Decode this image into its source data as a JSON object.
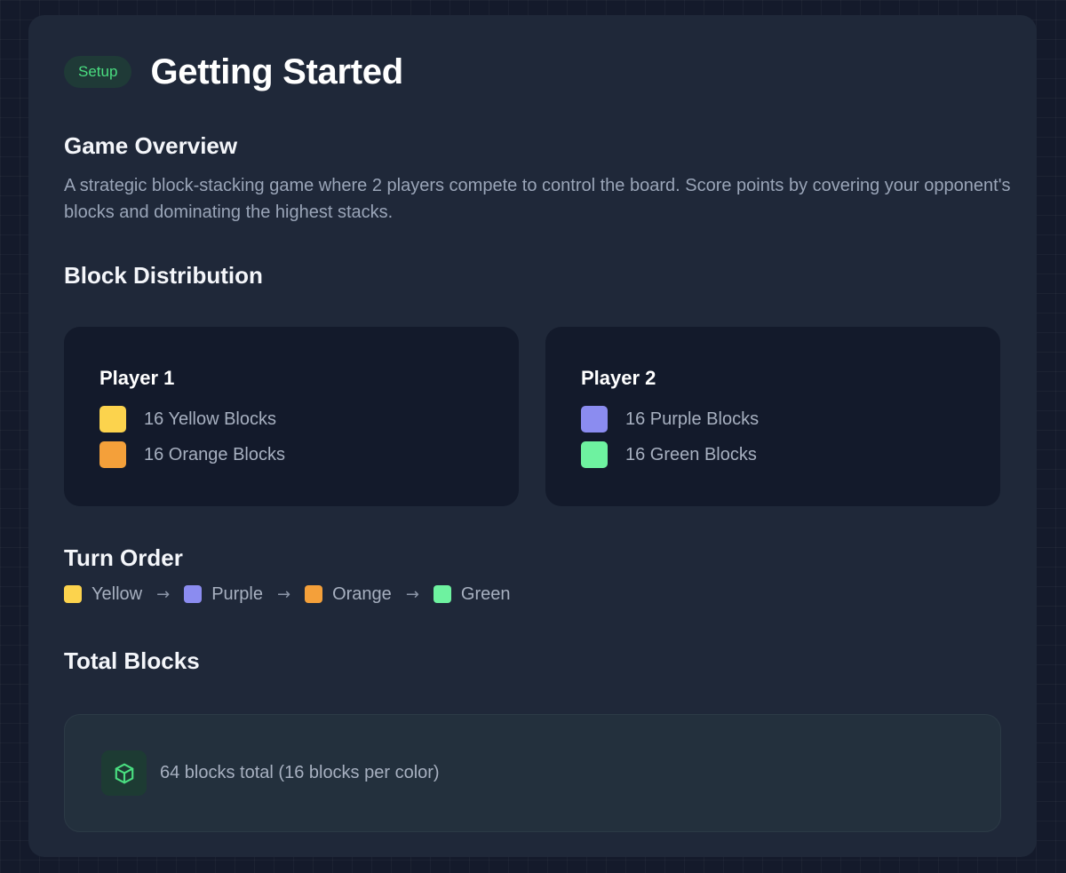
{
  "header": {
    "badge": "Setup",
    "title": "Getting Started"
  },
  "overview": {
    "title": "Game Overview",
    "text": "A strategic block-stacking game where 2 players compete to control the board. Score points by covering your opponent's blocks and dominating the highest stacks."
  },
  "distribution": {
    "title": "Block Distribution",
    "players": [
      {
        "name": "Player 1",
        "blocks": [
          {
            "label": "16 Yellow Blocks",
            "color": "#fcd34d"
          },
          {
            "label": "16 Orange Blocks",
            "color": "#f4a03a"
          }
        ]
      },
      {
        "name": "Player 2",
        "blocks": [
          {
            "label": "16 Purple Blocks",
            "color": "#8b8cf0"
          },
          {
            "label": "16 Green Blocks",
            "color": "#6ef2a0"
          }
        ]
      }
    ]
  },
  "turn_order": {
    "title": "Turn Order",
    "steps": [
      {
        "label": "Yellow",
        "color": "#fcd34d"
      },
      {
        "label": "Purple",
        "color": "#8b8cf0"
      },
      {
        "label": "Orange",
        "color": "#f4a03a"
      },
      {
        "label": "Green",
        "color": "#6ef2a0"
      }
    ],
    "arrow_icon": "arrow-right-icon"
  },
  "total": {
    "title": "Total Blocks",
    "icon": "cube-icon",
    "text": "64 blocks total (16 blocks per color)"
  },
  "colors": {
    "accent_green": "#4ade80",
    "card_bg": "#1f2839",
    "inner_card_bg": "#131a2b"
  }
}
